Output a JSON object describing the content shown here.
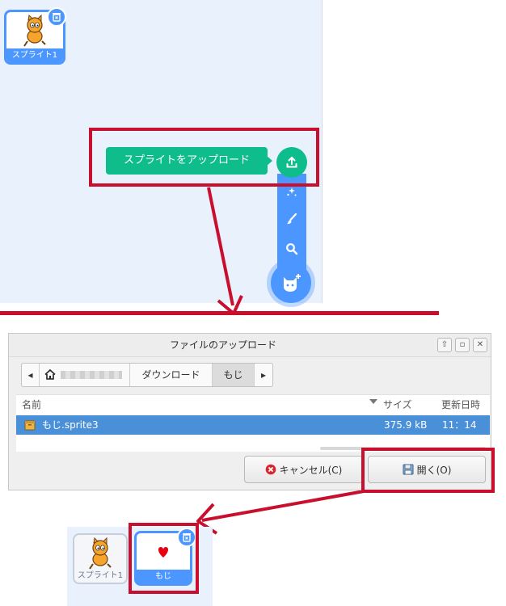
{
  "top_pane": {
    "sprite_tile": {
      "label": "スプライト1"
    },
    "upload_tooltip": "スプライトをアップロード",
    "icons": [
      "delete-icon",
      "upload-icon",
      "surprise-icon",
      "paint-icon",
      "search-icon",
      "choose-sprite-icon"
    ]
  },
  "dialog": {
    "title": "ファイルのアップロード",
    "path": [
      "ダウンロード",
      "もじ"
    ],
    "columns": {
      "name": "名前",
      "size": "サイズ",
      "modified": "更新日時"
    },
    "file": {
      "name": "もじ.sprite3",
      "size": "375.9 kB",
      "time": "11：14"
    },
    "cancel_label": "キャンセル(C)",
    "open_label": "開く(O)"
  },
  "bottom_pane": {
    "sprites": [
      {
        "label": "スプライト1"
      },
      {
        "label": "もじ"
      }
    ]
  },
  "colors": {
    "scratch_blue": "#4c97ff",
    "scratch_green": "#0fbd8c",
    "annotation_red": "#c8102e",
    "selection_blue": "#4a90d9"
  }
}
